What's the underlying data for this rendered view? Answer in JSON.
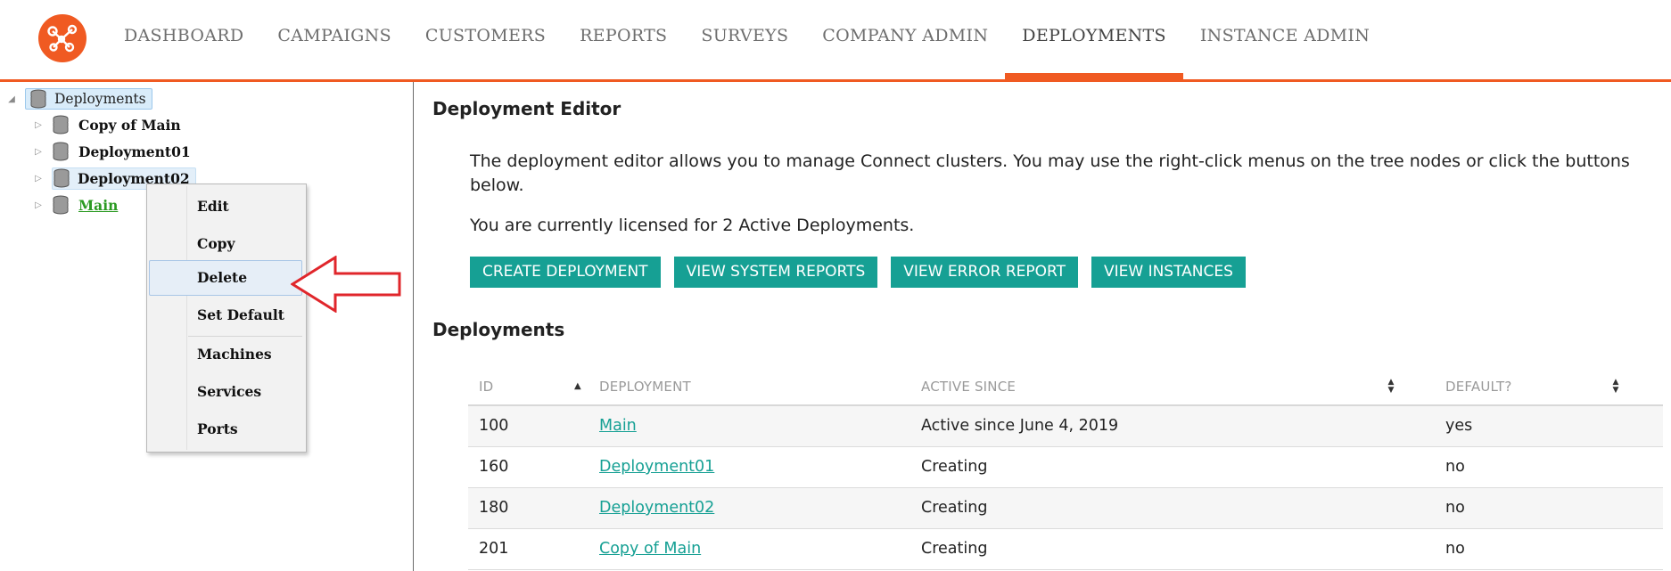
{
  "colors": {
    "brand": "#f05a22",
    "teal": "#16a094",
    "default_green": "#2b9a22",
    "arrow_red": "#e0262b"
  },
  "logo": {
    "icon": "network-nodes-icon"
  },
  "nav": {
    "items": [
      "DASHBOARD",
      "CAMPAIGNS",
      "CUSTOMERS",
      "REPORTS",
      "SURVEYS",
      "COMPANY ADMIN",
      "DEPLOYMENTS",
      "INSTANCE ADMIN"
    ],
    "active": "DEPLOYMENTS"
  },
  "tree": {
    "root": {
      "label": "Deployments",
      "icon": "database-stack-icon"
    },
    "children": [
      "Copy of Main",
      "Deployment01",
      "Deployment02",
      "Main"
    ],
    "default_child": "Main"
  },
  "context_menu": {
    "groups": [
      [
        "Edit",
        "Copy",
        "Delete",
        "Set Default"
      ],
      [
        "Machines",
        "Services",
        "Ports"
      ]
    ],
    "highlighted": "Delete"
  },
  "editor": {
    "title": "Deployment Editor",
    "description": "The deployment editor allows you to manage Connect clusters. You may use the right-click menus on the tree nodes or click the buttons below.",
    "license_text": "You are currently licensed for 2 Active Deployments.",
    "buttons": [
      "CREATE DEPLOYMENT",
      "VIEW SYSTEM REPORTS",
      "VIEW ERROR REPORT",
      "VIEW INSTANCES"
    ]
  },
  "deployments": {
    "title": "Deployments",
    "columns": [
      "ID",
      "DEPLOYMENT",
      "ACTIVE SINCE",
      "DEFAULT?"
    ],
    "rows": [
      {
        "id": "100",
        "name": "Main",
        "active_since": "Active since June 4, 2019",
        "default": "yes"
      },
      {
        "id": "160",
        "name": "Deployment01",
        "active_since": "Creating",
        "default": "no"
      },
      {
        "id": "180",
        "name": "Deployment02",
        "active_since": "Creating",
        "default": "no"
      },
      {
        "id": "201",
        "name": "Copy of Main",
        "active_since": "Creating",
        "default": "no"
      }
    ]
  }
}
